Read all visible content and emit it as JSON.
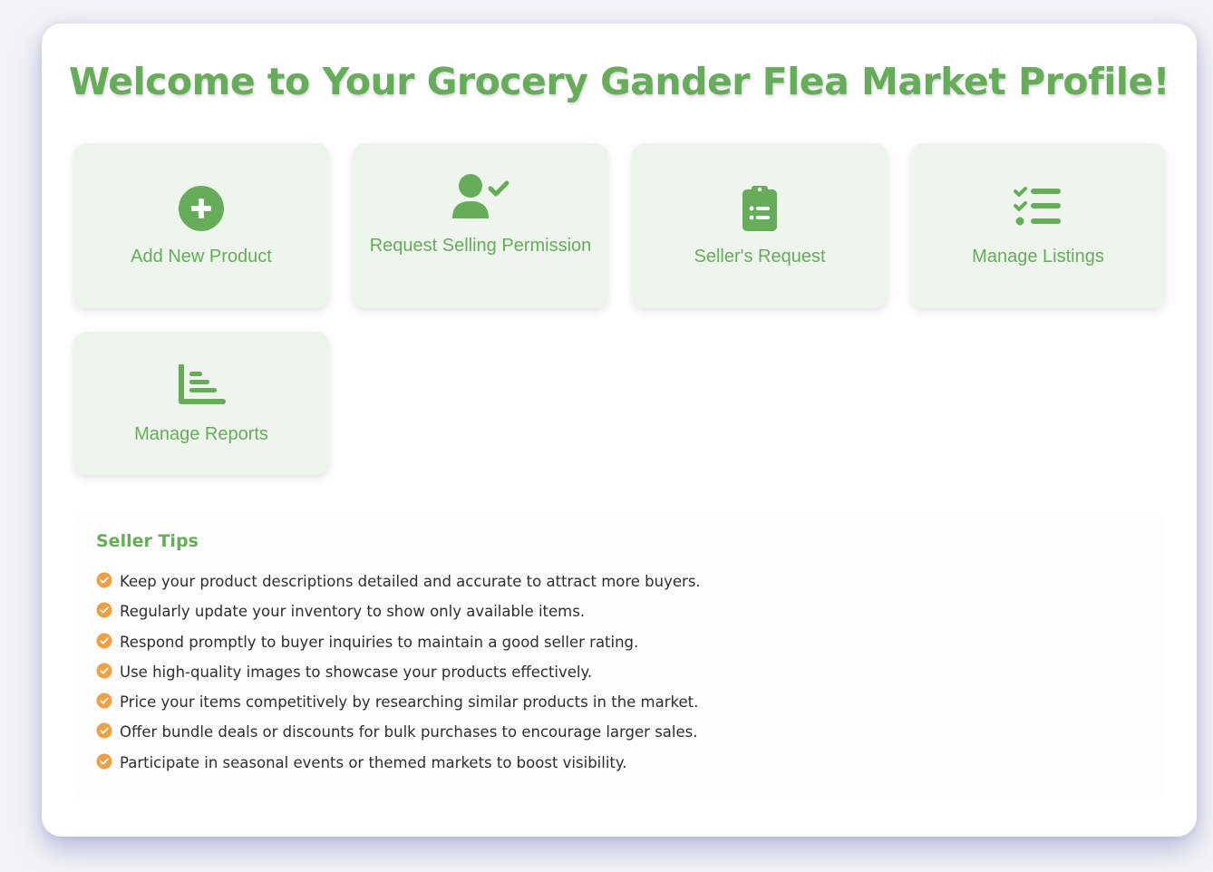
{
  "page": {
    "title": "Welcome to Your Grocery Gander Flea Market Profile!"
  },
  "theme": {
    "accent": "#66ac5b",
    "tile_background": "#eef5ec",
    "check_color": "#efa045"
  },
  "actions": [
    {
      "label": "Add New Product",
      "icon": "plus-circle-icon"
    },
    {
      "label": "Request Selling Permission",
      "icon": "user-check-icon"
    },
    {
      "label": "Seller's Request",
      "icon": "clipboard-list-icon"
    },
    {
      "label": "Manage Listings",
      "icon": "list-check-icon"
    },
    {
      "label": "Manage Reports",
      "icon": "chart-bar-icon"
    }
  ],
  "seller_tips": {
    "title": "Seller Tips",
    "items": [
      "Keep your product descriptions detailed and accurate to attract more buyers.",
      "Regularly update your inventory to show only available items.",
      "Respond promptly to buyer inquiries to maintain a good seller rating.",
      "Use high-quality images to showcase your products effectively.",
      "Price your items competitively by researching similar products in the market.",
      "Offer bundle deals or discounts for bulk purchases to encourage larger sales.",
      "Participate in seasonal events or themed markets to boost visibility."
    ]
  }
}
